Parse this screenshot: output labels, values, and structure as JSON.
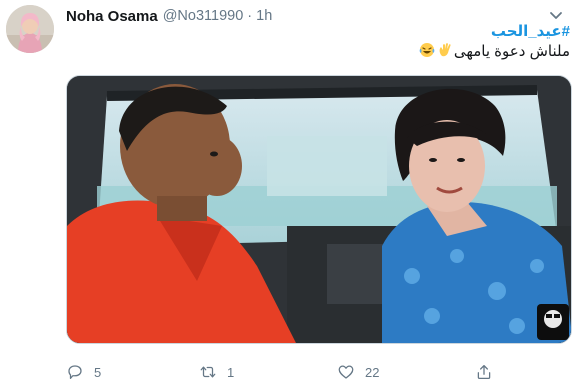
{
  "tweet": {
    "author": {
      "display_name": "Noha Osama",
      "handle": "@No311990",
      "separator": "·",
      "time": "1h"
    },
    "text": {
      "hashtag": "#عيد_الحب",
      "line": "ملناش دعوة يامهى",
      "emojis": [
        "waving-hand-emoji",
        "tears-of-joy-emoji"
      ]
    },
    "media": {
      "type": "photo",
      "description_icons": [
        "photo"
      ]
    },
    "actions": {
      "reply_count": "5",
      "retweet_count": "1",
      "like_count": "22",
      "share_count": ""
    }
  },
  "colors": {
    "link": "#1b95e0",
    "secondary_text": "#657786",
    "primary_text": "#14171a",
    "border": "#ccd6dd"
  }
}
